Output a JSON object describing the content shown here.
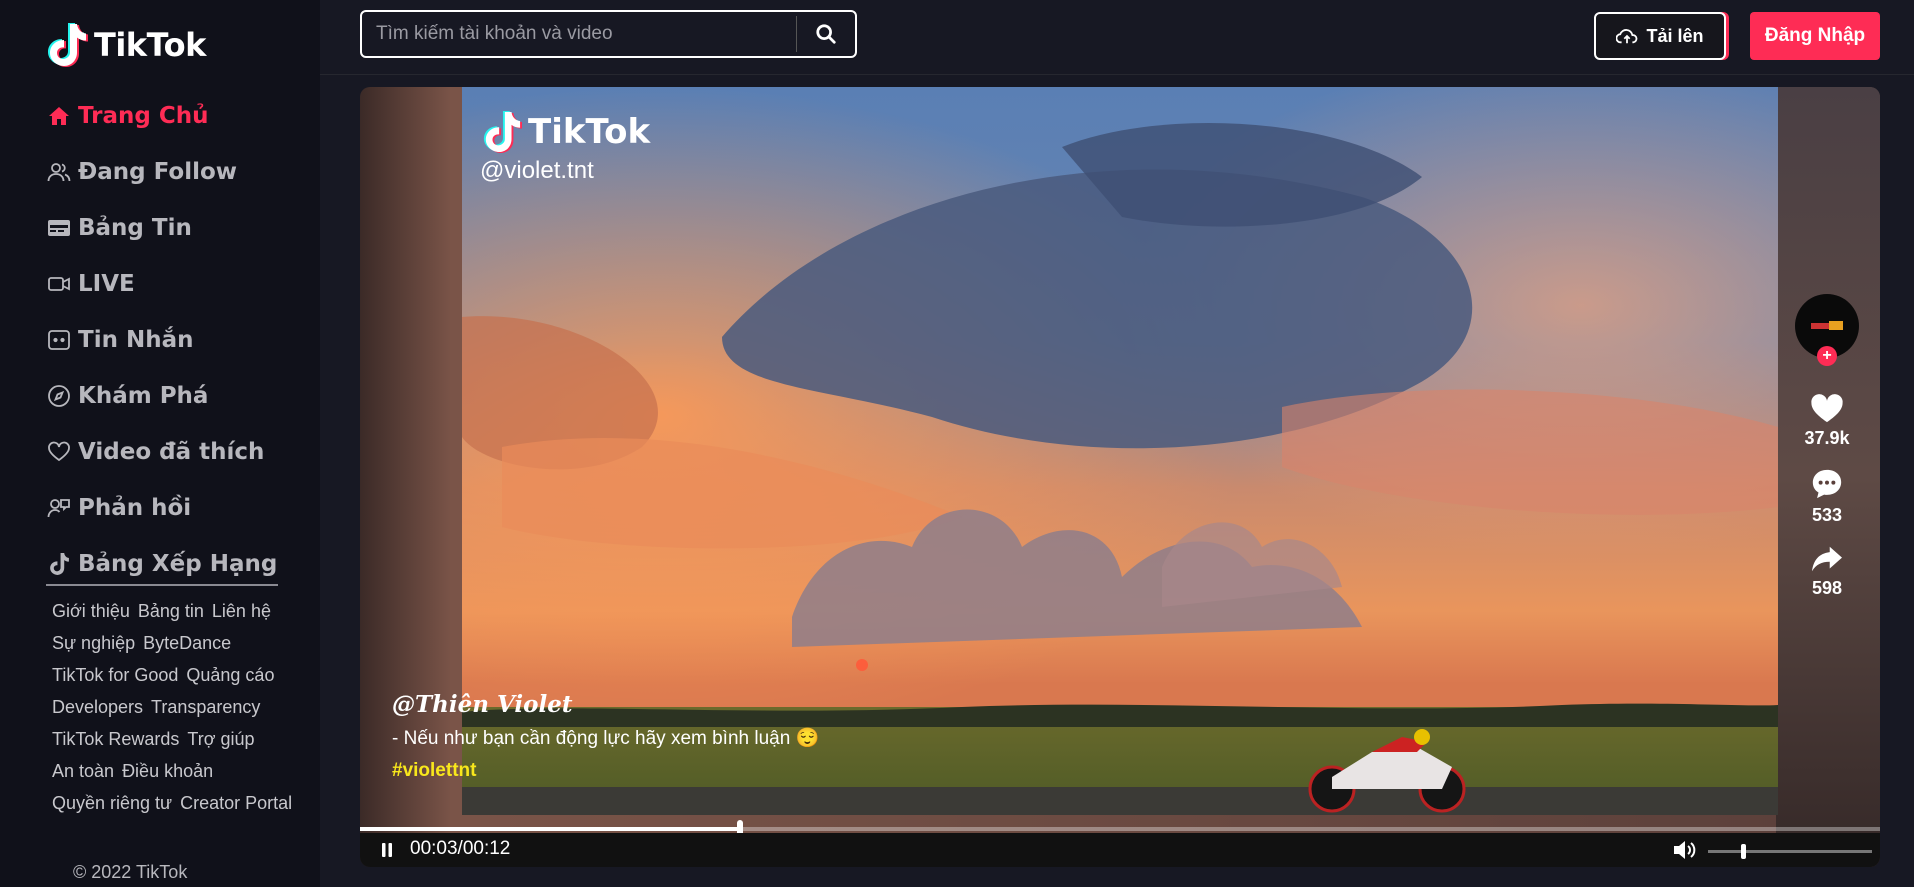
{
  "app": {
    "name": "TikTok"
  },
  "search": {
    "placeholder": "Tìm kiếm tài khoản và video"
  },
  "header": {
    "upload_label": "Tải lên",
    "login_label": "Đăng Nhập"
  },
  "sidebar": {
    "items": [
      {
        "label": "Trang Chủ",
        "icon": "home-icon",
        "active": true
      },
      {
        "label": "Đang Follow",
        "icon": "users-icon"
      },
      {
        "label": "Bảng Tin",
        "icon": "feed-icon"
      },
      {
        "label": "LIVE",
        "icon": "live-video-icon"
      },
      {
        "label": "Tin Nhắn",
        "icon": "message-icon"
      },
      {
        "label": "Khám Phá",
        "icon": "compass-icon"
      },
      {
        "label": "Video đã thích",
        "icon": "heart-icon"
      },
      {
        "label": "Phản hồi",
        "icon": "feedback-icon"
      },
      {
        "label": "Bảng Xếp Hạng",
        "icon": "tiktok-note-icon"
      }
    ],
    "footer_links": [
      "Giới thiệu",
      "Bảng tin",
      "Liên hệ",
      "Sự nghiệp",
      "ByteDance",
      "TikTok for Good",
      "Quảng cáo",
      "Developers",
      "Transparency",
      "TikTok Rewards",
      "Trợ giúp",
      "An toàn",
      "Điều khoản",
      "Quyền riêng tư",
      "Creator Portal"
    ],
    "copyright": "© 2022 TikTok"
  },
  "video": {
    "watermark_logo": "TikTok",
    "watermark_user": "@violet.tnt",
    "author": "@Thiên Violet",
    "description": "- Nếu như bạn cần động lực hãy xem bình luận 😌",
    "hashtag": "#violettnt",
    "likes": "37.9k",
    "comments": "533",
    "shares": "598",
    "time": "00:03/00:12",
    "progress": 0.25,
    "volume": 0.2
  },
  "colors": {
    "accent": "#fe2c55",
    "sidebar_bg": "#10111a",
    "main_bg": "#171823",
    "hashtag": "#f8e71c"
  }
}
